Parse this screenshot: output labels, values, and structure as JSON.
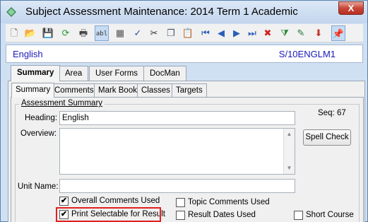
{
  "window": {
    "title": "Subject Assessment Maintenance:  2014 Term 1 Academic",
    "close_glyph": "X"
  },
  "toolbar": {
    "buttons": [
      {
        "icon": "new-document-icon",
        "glyph": "🗋",
        "color": "#555555"
      },
      {
        "icon": "open-folder-icon",
        "glyph": "📂",
        "color": "#d9a520"
      },
      {
        "icon": "save-icon",
        "glyph": "💾",
        "color": "#8a2b8a"
      },
      {
        "icon": "refresh-icon",
        "glyph": "⟳",
        "color": "#2a9a3a"
      },
      {
        "icon": "print-icon",
        "glyph": "🖶",
        "color": "#444444"
      },
      {
        "icon": "text-field-icon",
        "glyph": "abl",
        "color": "#333333",
        "active": true
      },
      {
        "icon": "calculator-icon",
        "glyph": "▦",
        "color": "#555555"
      },
      {
        "icon": "spell-check-icon",
        "glyph": "✓",
        "color": "#2255aa"
      },
      {
        "icon": "cut-icon",
        "glyph": "✂",
        "color": "#333333"
      },
      {
        "icon": "copy-icon",
        "glyph": "❐",
        "color": "#445566"
      },
      {
        "icon": "paste-icon",
        "glyph": "📋",
        "color": "#a0782a"
      },
      {
        "icon": "first-record-icon",
        "glyph": "⏮",
        "color": "#2a5fb8"
      },
      {
        "icon": "previous-record-icon",
        "glyph": "◀",
        "color": "#2a5fb8"
      },
      {
        "icon": "next-record-icon",
        "glyph": "▶",
        "color": "#2a5fb8"
      },
      {
        "icon": "last-record-icon",
        "glyph": "⏭",
        "color": "#2a5fb8"
      },
      {
        "icon": "delete-icon",
        "glyph": "✖",
        "color": "#d42020"
      },
      {
        "icon": "filter-icon",
        "glyph": "⧩",
        "color": "#2a8a3a"
      },
      {
        "icon": "approve-icon",
        "glyph": "✎",
        "color": "#2a7a3a"
      },
      {
        "icon": "download-icon",
        "glyph": "⬇",
        "color": "#c0392b"
      },
      {
        "icon": "pin-icon",
        "glyph": "📌",
        "color": "#2a5fb8",
        "active": true
      }
    ]
  },
  "record": {
    "name": "English",
    "code": "S/10ENGLM1"
  },
  "outer_tabs": [
    "Summary",
    "Area",
    "User Forms",
    "DocMan"
  ],
  "inner_tabs": [
    "Summary",
    "Comments",
    "Mark Book",
    "Classes",
    "Targets"
  ],
  "form": {
    "group_title": "Assessment Summary",
    "heading_label": "Heading:",
    "heading_value": "English",
    "seq_label": "Seq:",
    "seq_value": "67",
    "overview_label": "Overview:",
    "spell_check_label": "Spell Check",
    "unit_name_label": "Unit Name:",
    "unit_name_value": "",
    "checkboxes": {
      "overall_comments": {
        "label": "Overall Comments Used",
        "checked": true
      },
      "print_selectable": {
        "label": "Print Selectable for Result",
        "checked": true
      },
      "topic_comments": {
        "label": "Topic Comments Used",
        "checked": false
      },
      "result_dates": {
        "label": "Result Dates Used",
        "checked": false
      },
      "short_course": {
        "label": "Short Course",
        "checked": false
      }
    },
    "check_glyph": "✔",
    "scroll_up": "▲",
    "scroll_down": "▼"
  }
}
